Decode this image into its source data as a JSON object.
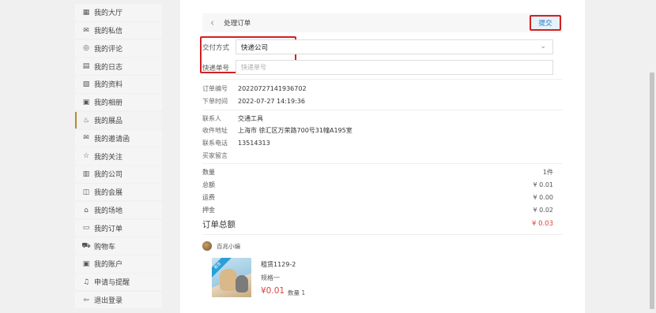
{
  "sidebar": {
    "items": [
      {
        "icon": "▦",
        "label": "我的大厅"
      },
      {
        "icon": "✉",
        "label": "我的私信"
      },
      {
        "icon": "◎",
        "label": "我的评论"
      },
      {
        "icon": "▤",
        "label": "我的日志"
      },
      {
        "icon": "▧",
        "label": "我的资料"
      },
      {
        "icon": "▣",
        "label": "我的相册"
      },
      {
        "icon": "♨",
        "label": "我的展品"
      },
      {
        "icon": "✉",
        "label": "我的邀请函"
      },
      {
        "icon": "☆",
        "label": "我的关注"
      },
      {
        "icon": "▥",
        "label": "我的公司"
      },
      {
        "icon": "◫",
        "label": "我的会展"
      },
      {
        "icon": "⌂",
        "label": "我的场地"
      },
      {
        "icon": "▭",
        "label": "我的订单"
      },
      {
        "icon": "⛟",
        "label": "购物车"
      },
      {
        "icon": "▣",
        "label": "我的账户"
      },
      {
        "icon": "♫",
        "label": "申请与提醒"
      },
      {
        "icon": "⇦",
        "label": "退出登录"
      }
    ]
  },
  "header": {
    "title": "处理订单",
    "submit_label": "提交"
  },
  "form": {
    "delivery_label": "交付方式",
    "delivery_value": "快递公司",
    "tracking_label": "快递单号",
    "tracking_placeholder": "快递单号"
  },
  "order": {
    "number_label": "订单编号",
    "number": "20220727141936702",
    "time_label": "下单时间",
    "time": "2022-07-27 14:19:36"
  },
  "buyer": {
    "contact_label": "联系人",
    "contact": "交通工具",
    "address_label": "收件地址",
    "address": "上海市 徐汇区万荣路700号31幢A195室",
    "phone_label": "联系电话",
    "phone": "13514313",
    "message_label": "买家留言"
  },
  "summary": {
    "qty_label": "数量",
    "qty": "1件",
    "total_label": "总额",
    "total": "¥ 0.01",
    "shipping_label": "运费",
    "shipping": "¥ 0.00",
    "deposit_label": "押金",
    "deposit": "¥ 0.02",
    "grand_label": "订单总额",
    "grand": "¥ 0.03"
  },
  "shop": {
    "name": "百兆小编"
  },
  "product": {
    "badge": "租赁",
    "name": "租赁1129-2",
    "spec": "规格一",
    "price": "¥0.01",
    "qty": "数量 1"
  },
  "colors": {
    "accent_red": "#e0413c",
    "link_blue": "#2b7bc4",
    "highlight_border": "#d32020",
    "active_bar": "#b58b2f"
  }
}
